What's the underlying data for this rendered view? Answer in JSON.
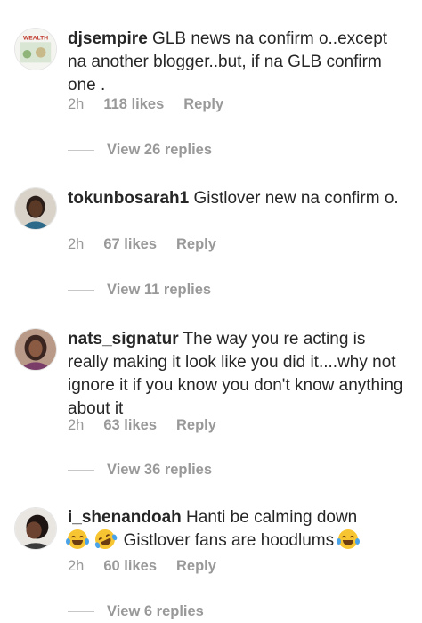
{
  "comments": [
    {
      "username": "djsempire",
      "text": "GLB news na confirm o..except na another blogger..but, if na GLB confirm one .",
      "time": "2h",
      "likes": "118 likes",
      "reply": "Reply",
      "view_replies": "View 26 replies",
      "avatar_text": "WEALTH"
    },
    {
      "username": "tokunbosarah1",
      "text": "Gistlover new na confirm o.",
      "time": "2h",
      "likes": "67 likes",
      "reply": "Reply",
      "view_replies": "View 11 replies"
    },
    {
      "username": "nats_signatur",
      "text": "The way you re acting is really making it look like you did it....why not ignore it if you know you don't know anything about it",
      "time": "2h",
      "likes": "63 likes",
      "reply": "Reply",
      "view_replies": "View 36 replies"
    },
    {
      "username": "i_shenandoah",
      "text_line1": "Hanti be calming down",
      "text_line2": "Gistlover fans are hoodlums",
      "time": "2h",
      "likes": "60 likes",
      "reply": "Reply",
      "view_replies": "View 6 replies"
    }
  ]
}
